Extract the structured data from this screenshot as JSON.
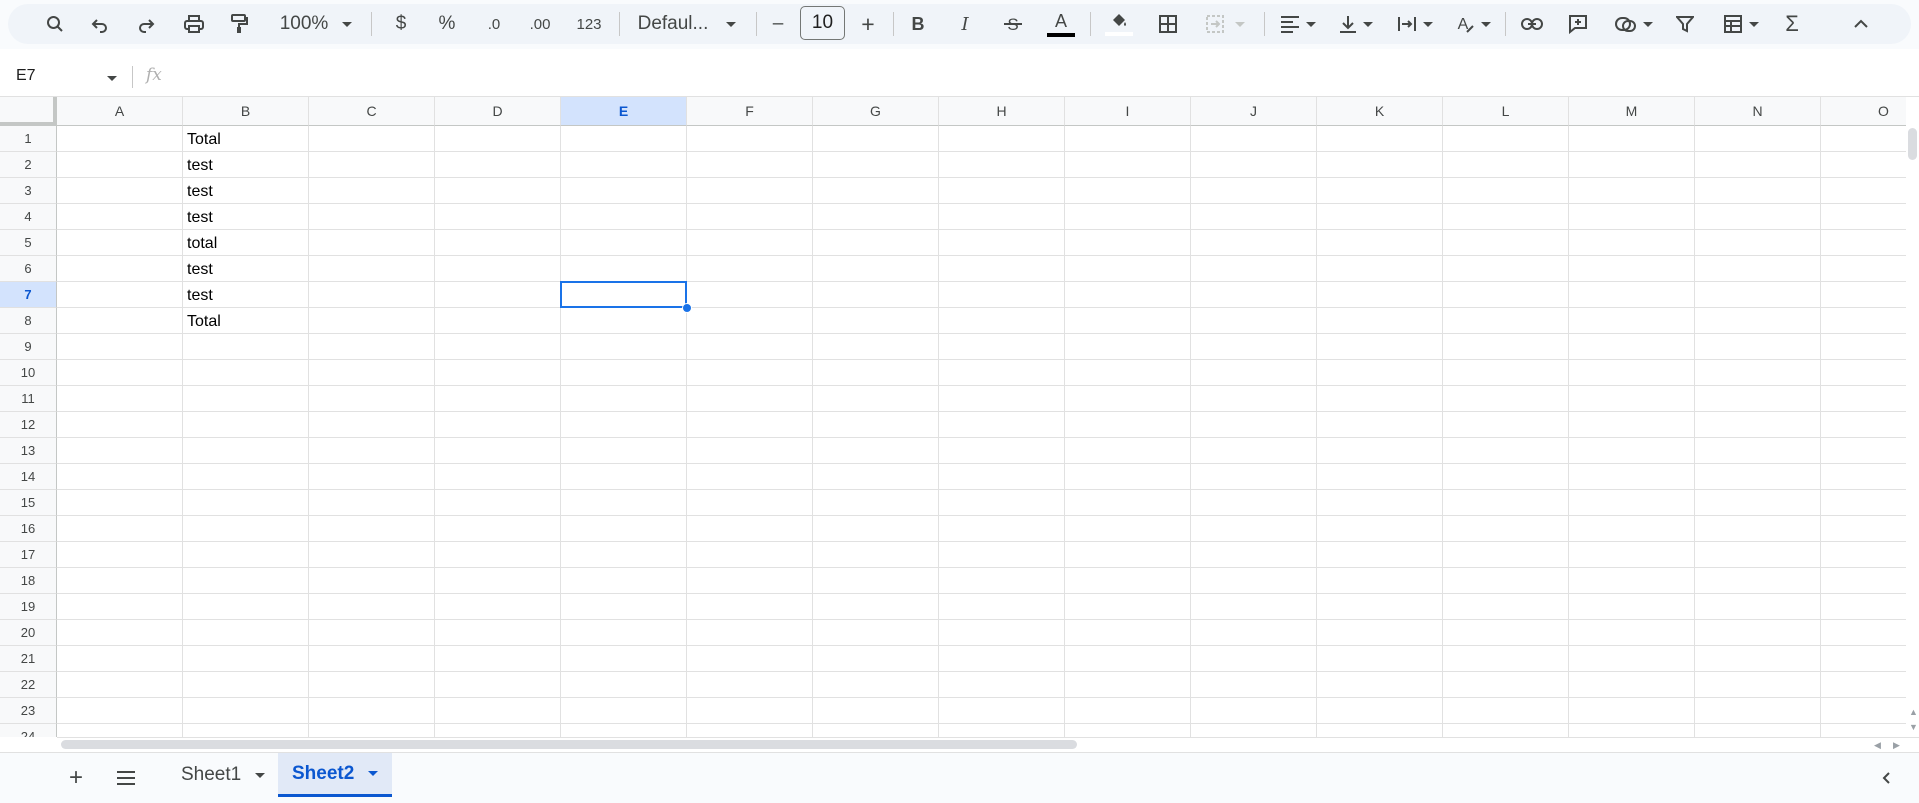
{
  "toolbar": {
    "zoom": "100%",
    "currency": "$",
    "percent": "%",
    "decrease_decimal": ".0",
    "increase_decimal": ".00",
    "number_format": "123",
    "font_name": "Defaul...",
    "font_size": "10",
    "minus": "–",
    "plus": "+",
    "bold": "B",
    "italic": "I",
    "text_color_letter": "A"
  },
  "formula_bar": {
    "cell_reference": "E7",
    "fx": "fx"
  },
  "grid": {
    "columns": [
      "A",
      "B",
      "C",
      "D",
      "E",
      "F",
      "G",
      "H",
      "I",
      "J",
      "K",
      "L",
      "M",
      "N",
      "O"
    ],
    "selected_column": "E",
    "rows": [
      "1",
      "2",
      "3",
      "4",
      "5",
      "6",
      "7",
      "8",
      "9",
      "10",
      "11",
      "12",
      "13",
      "14",
      "15",
      "16",
      "17",
      "18",
      "19",
      "20",
      "21",
      "22",
      "23",
      "24"
    ],
    "selected_row": "7",
    "column_b_values": [
      "Total",
      "test",
      "test",
      "test",
      "total",
      "test",
      "test",
      "Total"
    ],
    "selected_cell": "E7"
  },
  "sheets": {
    "tabs": [
      "Sheet1",
      "Sheet2"
    ],
    "active": "Sheet2"
  },
  "colors": {
    "accent": "#0b57d0",
    "selection": "#1a73e8",
    "header_selected_bg": "#d3e3fd",
    "toolbar_bg": "#f0f4f9"
  }
}
